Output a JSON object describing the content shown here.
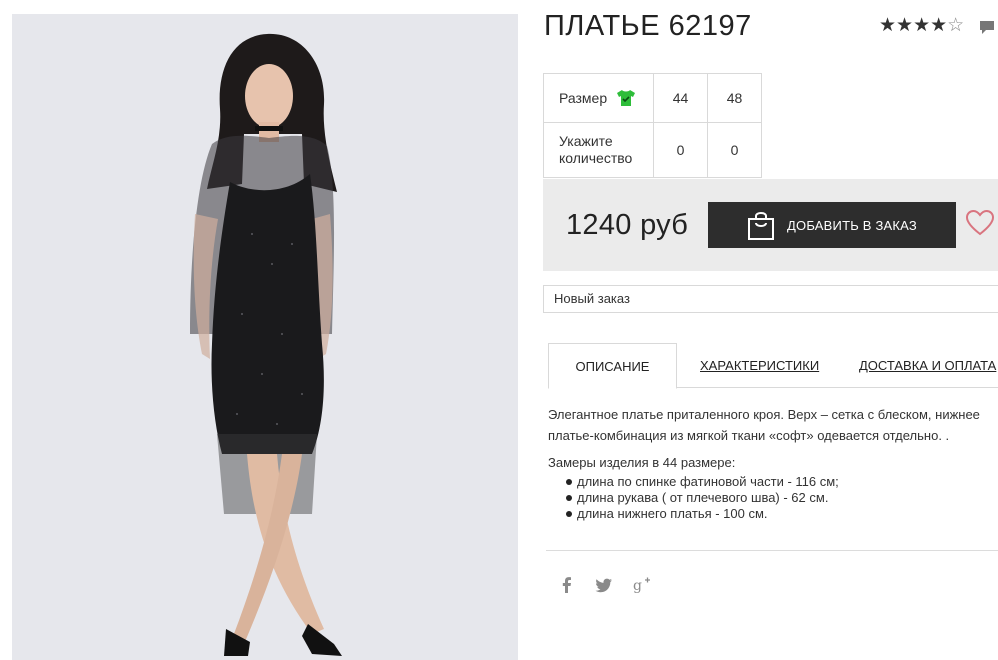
{
  "product": {
    "title": "ПЛАТЬЕ 62197",
    "rating": {
      "value": 4,
      "max": 5,
      "filled": "★★★★",
      "empty": "☆"
    },
    "photo_alt": "product-photo"
  },
  "sizes": {
    "size_label": "Размер",
    "qty_label": "Укажите количество",
    "columns": [
      "44",
      "48"
    ],
    "quantities": [
      "0",
      "0"
    ]
  },
  "buy": {
    "price": "1240 руб",
    "add_button_label": "ДОБАВИТЬ В ЗАКАЗ"
  },
  "order": {
    "selected": "Новый заказ"
  },
  "tabs": [
    {
      "label": "ОПИСАНИЕ",
      "active": true
    },
    {
      "label": "ХАРАКТЕРИСТИКИ",
      "active": false
    },
    {
      "label": "ДОСТАВКА И ОПЛАТА",
      "active": false
    }
  ],
  "description": {
    "text": "Элегантное платье приталенного кроя. Верх – сетка с блеском, нижнее платье-комбинация из мягкой ткани «софт» одевается отдельно. .",
    "measure_title": "Замеры изделия в 44 размере:",
    "measures": [
      "длина по спинке фатиновой части - 116 см;",
      "длина рукава ( от плечевого шва) - 62 см.",
      "длина нижнего платья - 100 см."
    ]
  },
  "social": [
    "facebook-icon",
    "twitter-icon",
    "google-plus-icon"
  ],
  "colors": {
    "button": "#2d2d2d",
    "buybar": "#ebebeb",
    "heart": "#d9747f",
    "size_icon": "#2ebd3a"
  }
}
